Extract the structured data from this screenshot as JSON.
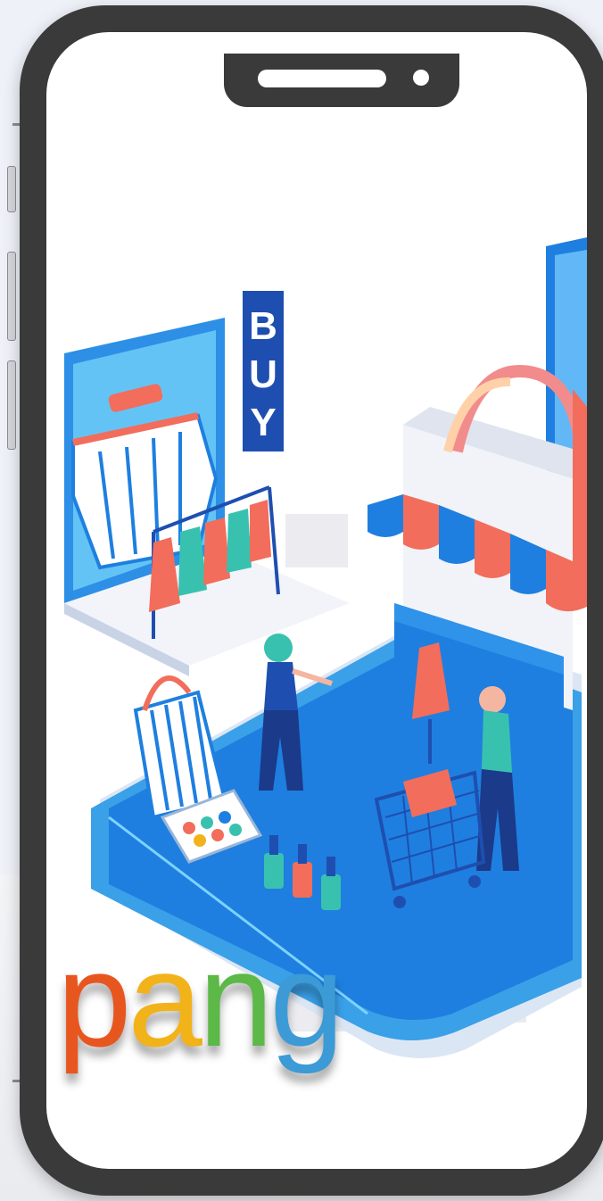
{
  "brand": {
    "logo_letters": [
      {
        "char": "p",
        "color": "#e8561f"
      },
      {
        "char": "a",
        "color": "#f2b21a"
      },
      {
        "char": "n",
        "color": "#5cb847"
      },
      {
        "char": "g",
        "color": "#3c9bd6"
      }
    ]
  },
  "illustration": {
    "sign_letters": [
      "B",
      "U",
      "Y"
    ]
  },
  "colors": {
    "phone_frame": "#3a3a3a",
    "screen": "#ffffff",
    "accent_blue": "#1e7fe0",
    "accent_coral": "#f26d5b",
    "accent_teal": "#39c1b0"
  }
}
